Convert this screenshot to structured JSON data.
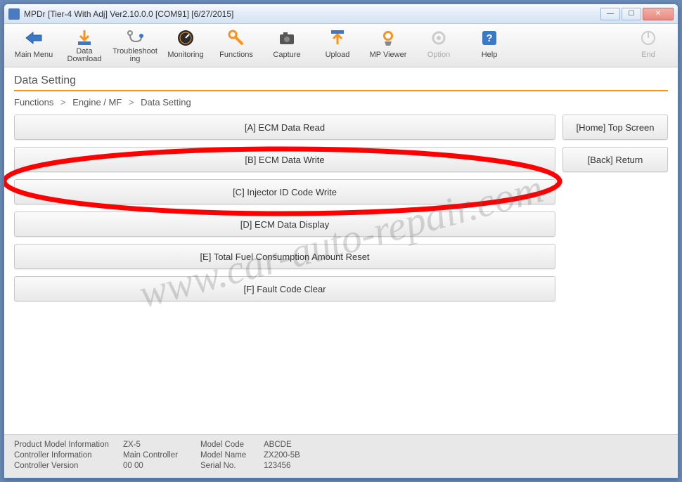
{
  "window": {
    "title": "MPDr [Tier-4 With Adj] Ver2.10.0.0 [COM91] [6/27/2015]"
  },
  "toolbar": {
    "main_menu": "Main Menu",
    "data_download": "Data\nDownload",
    "troubleshooting": "Troubleshoot\ning",
    "monitoring": "Monitoring",
    "functions": "Functions",
    "capture": "Capture",
    "upload": "Upload",
    "mp_viewer": "MP Viewer",
    "option": "Option",
    "help": "Help",
    "end": "End"
  },
  "page": {
    "title": "Data Setting",
    "breadcrumb": [
      "Functions",
      "Engine / MF",
      "Data Setting"
    ]
  },
  "buttons": {
    "a": "[A] ECM Data Read",
    "b": "[B] ECM Data Write",
    "c": "[C] Injector ID Code Write",
    "d": "[D] ECM Data Display",
    "e": "[E] Total Fuel Consumption Amount Reset",
    "f": "[F] Fault Code Clear"
  },
  "side": {
    "home": "[Home] Top Screen",
    "back": "[Back] Return"
  },
  "status": {
    "product_model_info_label": "Product Model Information",
    "product_model_info_value": "ZX-5",
    "controller_info_label": "Controller Information",
    "controller_info_value": "Main Controller",
    "controller_version_label": "Controller Version",
    "controller_version_value": "00 00",
    "model_code_label": "Model Code",
    "model_code_value": "ABCDE",
    "model_name_label": "Model Name",
    "model_name_value": "ZX200-5B",
    "serial_no_label": "Serial No.",
    "serial_no_value": "123456"
  },
  "watermark": "www.car-auto-repair.com"
}
